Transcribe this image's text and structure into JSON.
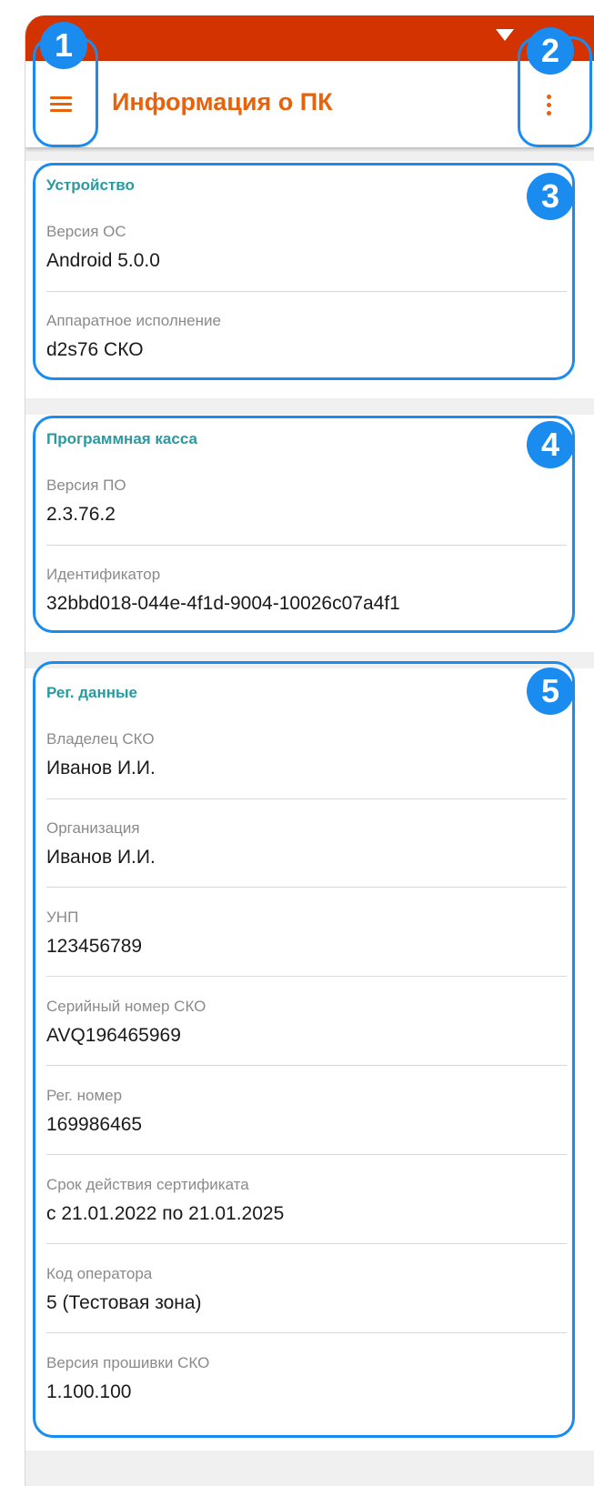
{
  "app": {
    "title": "Информация о ПК",
    "accent_color": "#e8620c",
    "statusbar_color": "#d23300",
    "header_color": "#2a9aa0",
    "annotation_color": "#1a8cf0"
  },
  "icons": {
    "menu": "hamburger-menu-icon",
    "more": "more-vert-icon",
    "wifi": "wifi-icon"
  },
  "annotations": [
    "1",
    "2",
    "3",
    "4",
    "5"
  ],
  "device": {
    "header": "Устройство",
    "fields": [
      {
        "label": "Версия ОС",
        "value": "Android 5.0.0"
      },
      {
        "label": "Аппаратное исполнение",
        "value": "d2s76 СКО"
      }
    ]
  },
  "cashbox": {
    "header": "Программная касса",
    "fields": [
      {
        "label": "Версия ПО",
        "value": "2.3.76.2"
      },
      {
        "label": "Идентификатор",
        "value": "32bbd018-044e-4f1d-9004-10026c07a4f1"
      }
    ]
  },
  "registration": {
    "header": "Рег. данные",
    "fields": [
      {
        "label": "Владелец СКО",
        "value": "Иванов И.И."
      },
      {
        "label": "Организация",
        "value": "Иванов И.И."
      },
      {
        "label": "УНП",
        "value": "123456789"
      },
      {
        "label": "Серийный номер СКО",
        "value": "AVQ196465969"
      },
      {
        "label": "Рег. номер",
        "value": "169986465"
      },
      {
        "label": "Срок действия сертификата",
        "value": "с 21.01.2022 по 21.01.2025"
      },
      {
        "label": "Код оператора",
        "value": "5 (Тестовая зона)"
      },
      {
        "label": "Версия прошивки СКО",
        "value": "1.100.100"
      }
    ]
  }
}
